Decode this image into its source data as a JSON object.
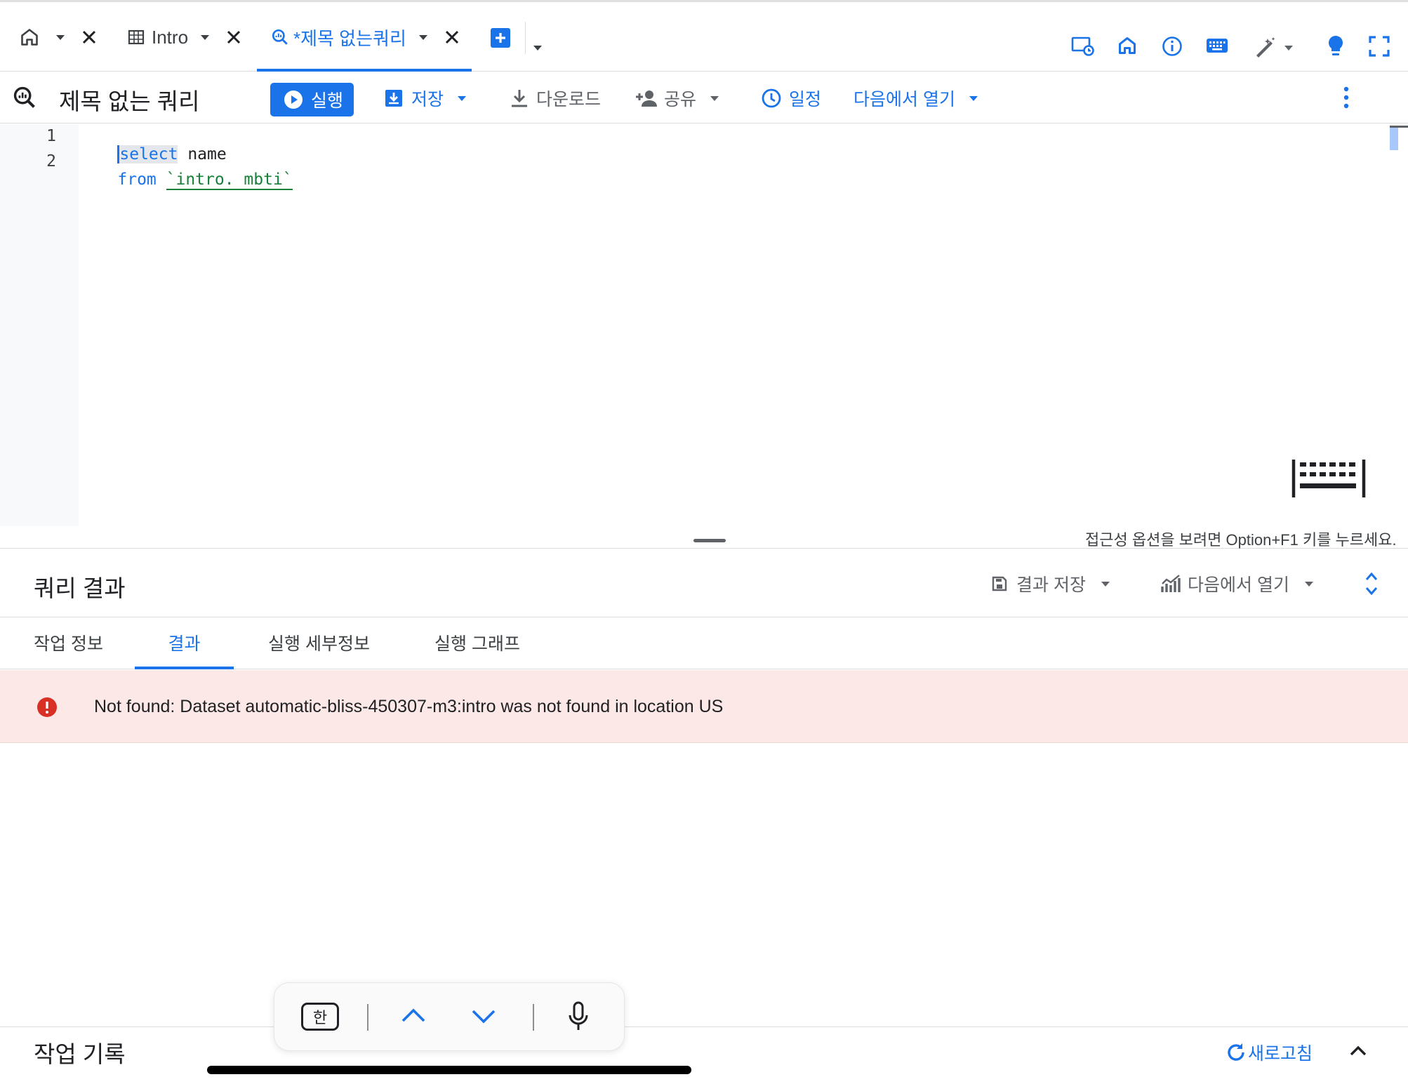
{
  "tabs": [
    {
      "label": ""
    },
    {
      "label": "Intro"
    },
    {
      "label": "*제목 없는쿼리"
    }
  ],
  "toolbar": {
    "query_title": "제목 없는 쿼리",
    "run": "실행",
    "save": "저장",
    "download": "다운로드",
    "share": "공유",
    "schedule": "일정",
    "open_in": "다음에서 열기"
  },
  "editor": {
    "lines": [
      {
        "num": "1",
        "kw": "select",
        "rest": " name"
      },
      {
        "num": "2",
        "kw": "from",
        "rest": " ",
        "str": "`intro. mbti`"
      }
    ],
    "a11y_hint": "접근성 옵션을 보려면 Option+F1 키를 누르세요."
  },
  "results": {
    "title": "쿼리 결과",
    "save_results": "결과 저장",
    "open_in": "다음에서 열기",
    "tabs": [
      "작업 정보",
      "결과",
      "실행 세부정보",
      "실행 그래프"
    ],
    "active_tab": 1,
    "error_message": "Not found: Dataset automatic-bliss-450307-m3:intro was not found in location US"
  },
  "history": {
    "title": "작업 기록",
    "refresh": "새로고침"
  },
  "keyboard_bar": {
    "lang_key": "한"
  },
  "colors": {
    "accent": "#1a73e8",
    "error": "#d93025",
    "error_bg": "#fce8e6",
    "string": "#188038"
  }
}
